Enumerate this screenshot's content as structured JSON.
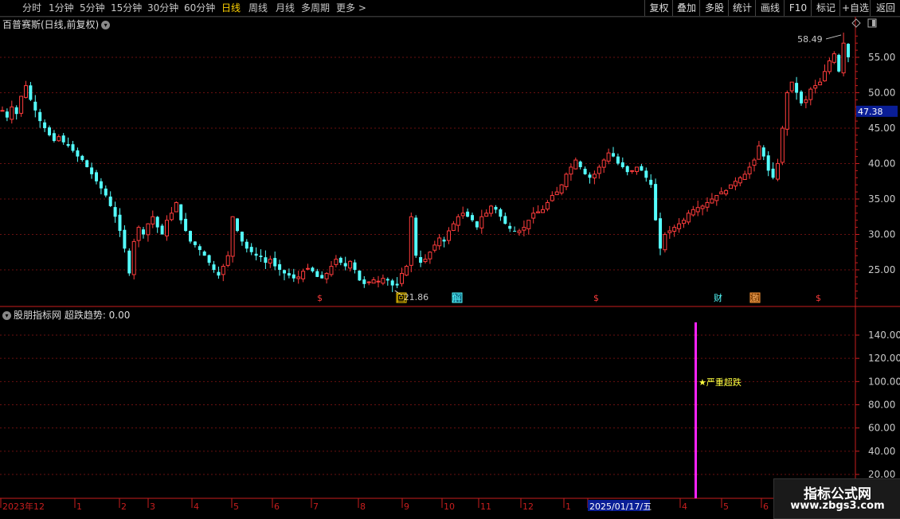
{
  "toolbar": {
    "periods": [
      {
        "label": "分时",
        "active": false
      },
      {
        "label": "1分钟",
        "active": false
      },
      {
        "label": "5分钟",
        "active": false
      },
      {
        "label": "15分钟",
        "active": false
      },
      {
        "label": "30分钟",
        "active": false
      },
      {
        "label": "60分钟",
        "active": false
      },
      {
        "label": "日线",
        "active": true
      },
      {
        "label": "周线",
        "active": false
      },
      {
        "label": "月线",
        "active": false
      },
      {
        "label": "多周期",
        "active": false
      },
      {
        "label": "更多 >",
        "active": false
      }
    ],
    "actions": [
      "复权",
      "叠加",
      "多股",
      "统计",
      "画线",
      "F10",
      "标记",
      "+自选",
      "返回"
    ]
  },
  "main_panel": {
    "title": "百普赛斯(日线,前复权)",
    "price_ticks": [
      "55.00",
      "50.00",
      "45.00",
      "40.00",
      "35.00",
      "30.00",
      "25.00"
    ],
    "current_price": "47.38",
    "high_label": "58.49",
    "low_label": "21.86",
    "event_markers": [
      {
        "label": "$",
        "kind": "s"
      },
      {
        "label": "回",
        "kind": "box-yellow"
      },
      {
        "label": "解",
        "kind": "box-cyan"
      },
      {
        "label": "$",
        "kind": "s"
      },
      {
        "label": "财",
        "kind": "text-cyan"
      },
      {
        "label": "激",
        "kind": "box-orange"
      },
      {
        "label": "$",
        "kind": "s"
      }
    ]
  },
  "sub_panel": {
    "title": "股朋指标网 超跌趋势: 0.00",
    "ticks": [
      "140.00",
      "120.00",
      "100.00",
      "80.00",
      "60.00",
      "40.00",
      "20.00"
    ],
    "signal_label": "★严重超跌"
  },
  "date_axis": {
    "labels": [
      "2023年12",
      "1",
      "2",
      "3",
      "4",
      "5",
      "6",
      "7",
      "8",
      "9",
      "10",
      "11",
      "12",
      "1",
      "2025/01/17/五",
      "4",
      "5",
      "6"
    ]
  },
  "watermark": {
    "line1": "指标公式网",
    "line2": "www.zbgs3.com"
  },
  "chart_data": {
    "type": "candlestick",
    "title": "百普赛斯(日线,前复权)",
    "ylim": [
      20.5,
      60.0
    ],
    "y_ticks": [
      25,
      30,
      35,
      40,
      45,
      50,
      55
    ],
    "current_price": 47.38,
    "high": 58.49,
    "low": 21.86,
    "close_path": [
      47.5,
      46.5,
      48.0,
      47.0,
      49.5,
      51.0,
      49.0,
      47.5,
      46.0,
      45.0,
      44.0,
      43.2,
      43.8,
      43.0,
      42.5,
      41.8,
      41.0,
      40.5,
      39.5,
      38.5,
      37.5,
      36.5,
      35.5,
      34.0,
      32.5,
      30.5,
      28.0,
      24.5,
      29.0,
      31.0,
      30.0,
      31.5,
      32.5,
      31.0,
      30.0,
      32.0,
      33.0,
      34.5,
      32.0,
      30.5,
      29.0,
      28.5,
      27.8,
      27.0,
      26.0,
      25.0,
      24.2,
      25.5,
      27.0,
      32.5,
      30.5,
      29.0,
      28.0,
      27.5,
      27.0,
      26.8,
      26.0,
      26.5,
      25.5,
      25.0,
      24.5,
      24.2,
      23.8,
      24.0,
      24.8,
      25.2,
      24.8,
      24.0,
      23.8,
      24.5,
      25.5,
      26.5,
      26.0,
      25.5,
      26.2,
      25.0,
      23.5,
      23.0,
      23.3,
      23.6,
      23.4,
      23.8,
      23.5,
      22.8,
      22.8,
      24.5,
      25.5,
      32.5,
      27.0,
      26.0,
      26.5,
      27.5,
      28.5,
      29.5,
      29.0,
      30.5,
      31.5,
      32.5,
      33.0,
      32.5,
      32.0,
      31.0,
      32.5,
      33.0,
      34.0,
      33.5,
      32.5,
      31.5,
      30.8,
      30.5,
      30.5,
      31.0,
      32.0,
      33.0,
      33.2,
      33.5,
      34.5,
      35.5,
      36.0,
      37.0,
      38.5,
      39.5,
      40.5,
      39.5,
      38.5,
      38.0,
      38.5,
      39.5,
      40.5,
      41.5,
      41.0,
      40.0,
      39.5,
      38.8,
      39.0,
      39.5,
      39.0,
      38.0,
      37.0,
      32.0,
      28.0,
      30.0,
      30.5,
      31.0,
      31.5,
      32.0,
      33.0,
      33.5,
      33.8,
      34.0,
      34.5,
      35.0,
      35.5,
      36.0,
      36.2,
      37.0,
      37.5,
      38.0,
      38.5,
      39.5,
      40.5,
      42.5,
      41.0,
      39.0,
      38.0,
      40.0,
      45.0,
      50.0,
      51.5,
      50.0,
      48.5,
      49.0,
      50.5,
      51.0,
      51.5,
      53.0,
      54.5,
      55.5,
      53.0,
      57.0,
      55.0
    ]
  }
}
